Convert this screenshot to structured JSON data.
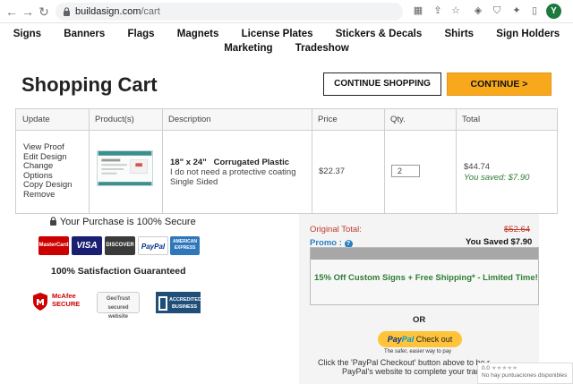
{
  "browser": {
    "url_host": "buildasign.com",
    "url_path": "/cart",
    "profile_initial": "Y"
  },
  "site_nav": {
    "row1": [
      "Signs",
      "Banners",
      "Flags",
      "Magnets",
      "License Plates",
      "Stickers & Decals",
      "Shirts",
      "Sign Holders"
    ],
    "row2": [
      "Marketing",
      "Tradeshow"
    ]
  },
  "page": {
    "title": "Shopping Cart",
    "continue_shopping_label": "CONTINUE SHOPPING",
    "continue_label": "CONTINUE >"
  },
  "cart": {
    "columns": [
      "Update",
      "Product(s)",
      "Description",
      "Price",
      "Qty.",
      "Total"
    ],
    "item": {
      "actions": [
        "View Proof",
        "Edit Design",
        "Change",
        "Options",
        "Copy Design",
        "Remove"
      ],
      "title": "18\" x 24\"   Corrugated Plastic",
      "desc_lines": [
        "I do not need a protective coating",
        "Single Sided"
      ],
      "price": "$22.37",
      "qty": "2",
      "total": "$44.74",
      "saved": "You saved: $7.90"
    }
  },
  "trust": {
    "secure_text": "Your Purchase is 100% Secure",
    "cards": [
      "MasterCard",
      "VISA",
      "DISCOVER",
      "PayPal",
      "AMERICAN EXPRESS"
    ],
    "guarantee": "100% Satisfaction Guaranteed",
    "badges": [
      "McAfee SECURE",
      "GeoTrust secured website",
      "ACCREDITED BUSINESS"
    ]
  },
  "summary": {
    "original_total_label": "Original Total:",
    "original_total_value": "$52.64",
    "promo_label": "Promo :",
    "you_saved": "You Saved $7.90",
    "promo_message": "15% Off Custom Signs + Free Shipping* - Limited Time!",
    "or_label": "OR",
    "paypal_pay": "Pay",
    "paypal_pal": "Pal",
    "paypal_checkout": "Check out",
    "paypal_tagline": "The safer, easier way to pay",
    "paypal_note_line1": "Click the 'PayPal Checkout' button above to be r",
    "paypal_note_line2": "PayPal's website to complete your transa"
  },
  "rating_widget": {
    "score": "0.0",
    "stars": "★★★★★",
    "text": "No hay puntuaciones disponibles"
  },
  "colors": {
    "accent_orange": "#f7a81b",
    "saved_green": "#2e7d32",
    "original_red": "#c0392b",
    "promo_blue": "#2a7fc1"
  }
}
